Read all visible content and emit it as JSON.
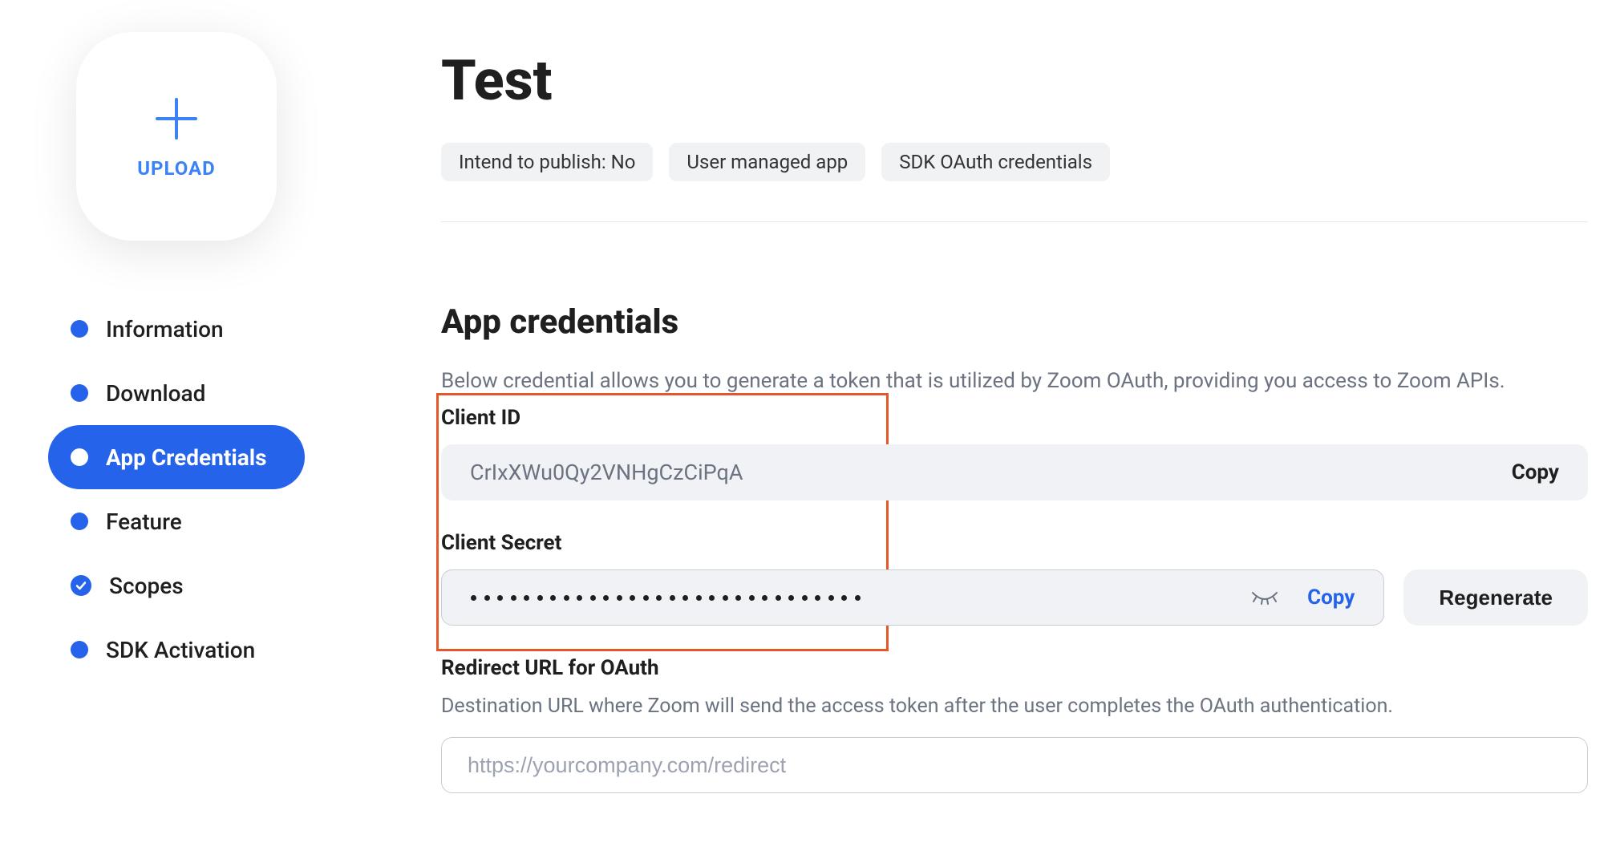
{
  "sidebar": {
    "upload_label": "UPLOAD",
    "items": [
      {
        "label": "Information",
        "state": "default"
      },
      {
        "label": "Download",
        "state": "default"
      },
      {
        "label": "App Credentials",
        "state": "active"
      },
      {
        "label": "Feature",
        "state": "default"
      },
      {
        "label": "Scopes",
        "state": "checked"
      },
      {
        "label": "SDK Activation",
        "state": "default"
      }
    ]
  },
  "header": {
    "title": "Test",
    "tags": [
      "Intend to publish: No",
      "User managed app",
      "SDK OAuth credentials"
    ]
  },
  "credentials": {
    "section_title": "App credentials",
    "description": "Below credential allows you to generate a token that is utilized by Zoom OAuth, providing you access to Zoom APIs.",
    "client_id_label": "Client ID",
    "client_id_value": "CrIxXWu0Qy2VNHgCzCiPqA",
    "client_id_copy": "Copy",
    "client_secret_label": "Client Secret",
    "client_secret_masked_count": 30,
    "client_secret_copy": "Copy",
    "regenerate_label": "Regenerate",
    "redirect_label": "Redirect URL for OAuth",
    "redirect_help": "Destination URL where Zoom will send the access token after the user completes the OAuth authentication.",
    "redirect_placeholder": "https://yourcompany.com/redirect"
  }
}
